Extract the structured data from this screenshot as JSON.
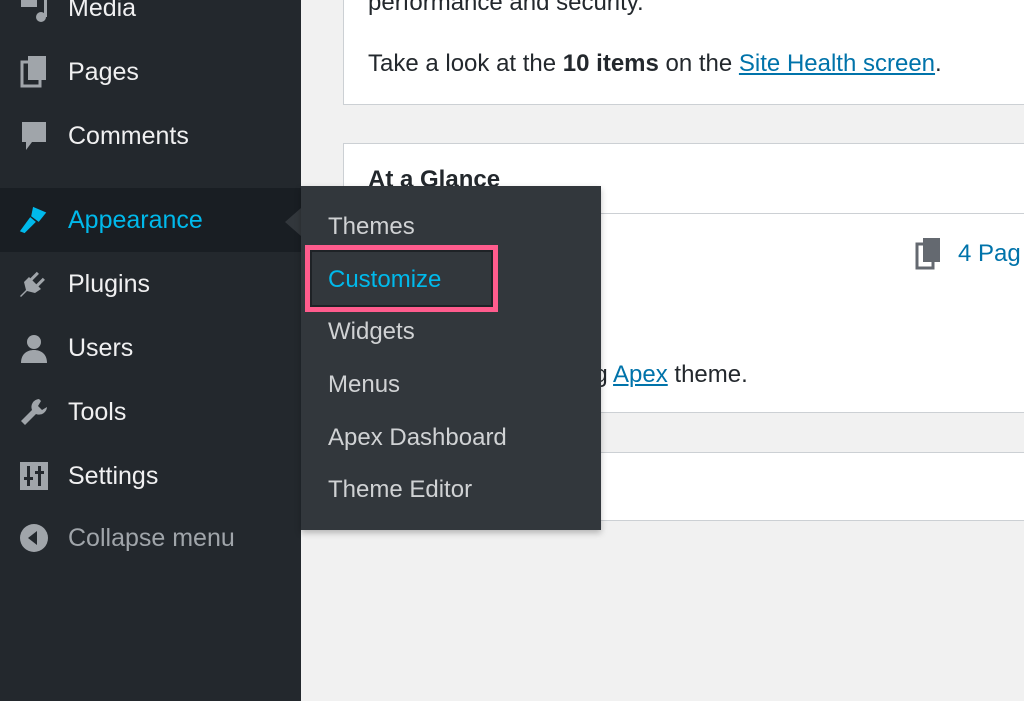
{
  "sidebar": {
    "items": [
      {
        "label": "Media",
        "icon": "media-icon"
      },
      {
        "label": "Pages",
        "icon": "pages-icon"
      },
      {
        "label": "Comments",
        "icon": "comments-icon"
      },
      {
        "label": "Appearance",
        "icon": "paintbrush-icon",
        "active": true
      },
      {
        "label": "Plugins",
        "icon": "plugin-icon"
      },
      {
        "label": "Users",
        "icon": "user-icon"
      },
      {
        "label": "Tools",
        "icon": "wrench-icon"
      },
      {
        "label": "Settings",
        "icon": "settings-icon"
      }
    ],
    "collapse_label": "Collapse menu"
  },
  "flyout": {
    "items": [
      {
        "label": "Themes"
      },
      {
        "label": "Customize",
        "current": true
      },
      {
        "label": "Widgets"
      },
      {
        "label": "Menus"
      },
      {
        "label": "Apex Dashboard"
      },
      {
        "label": "Theme Editor"
      }
    ],
    "highlight_color": "#ff5c8d"
  },
  "site_health": {
    "line1": "performance and security.",
    "prefix": "Take a look at the ",
    "count": "10 items",
    "middle": " on the ",
    "link": "Site Health screen",
    "suffix": "."
  },
  "glance": {
    "title": "At a Glance",
    "pages": "4 Pag",
    "theme_prefix": "ng ",
    "theme_link": "Apex",
    "theme_suffix": " theme."
  },
  "colors": {
    "sidebar": "#23282d",
    "accent": "#00b9eb",
    "link": "#0073aa"
  }
}
